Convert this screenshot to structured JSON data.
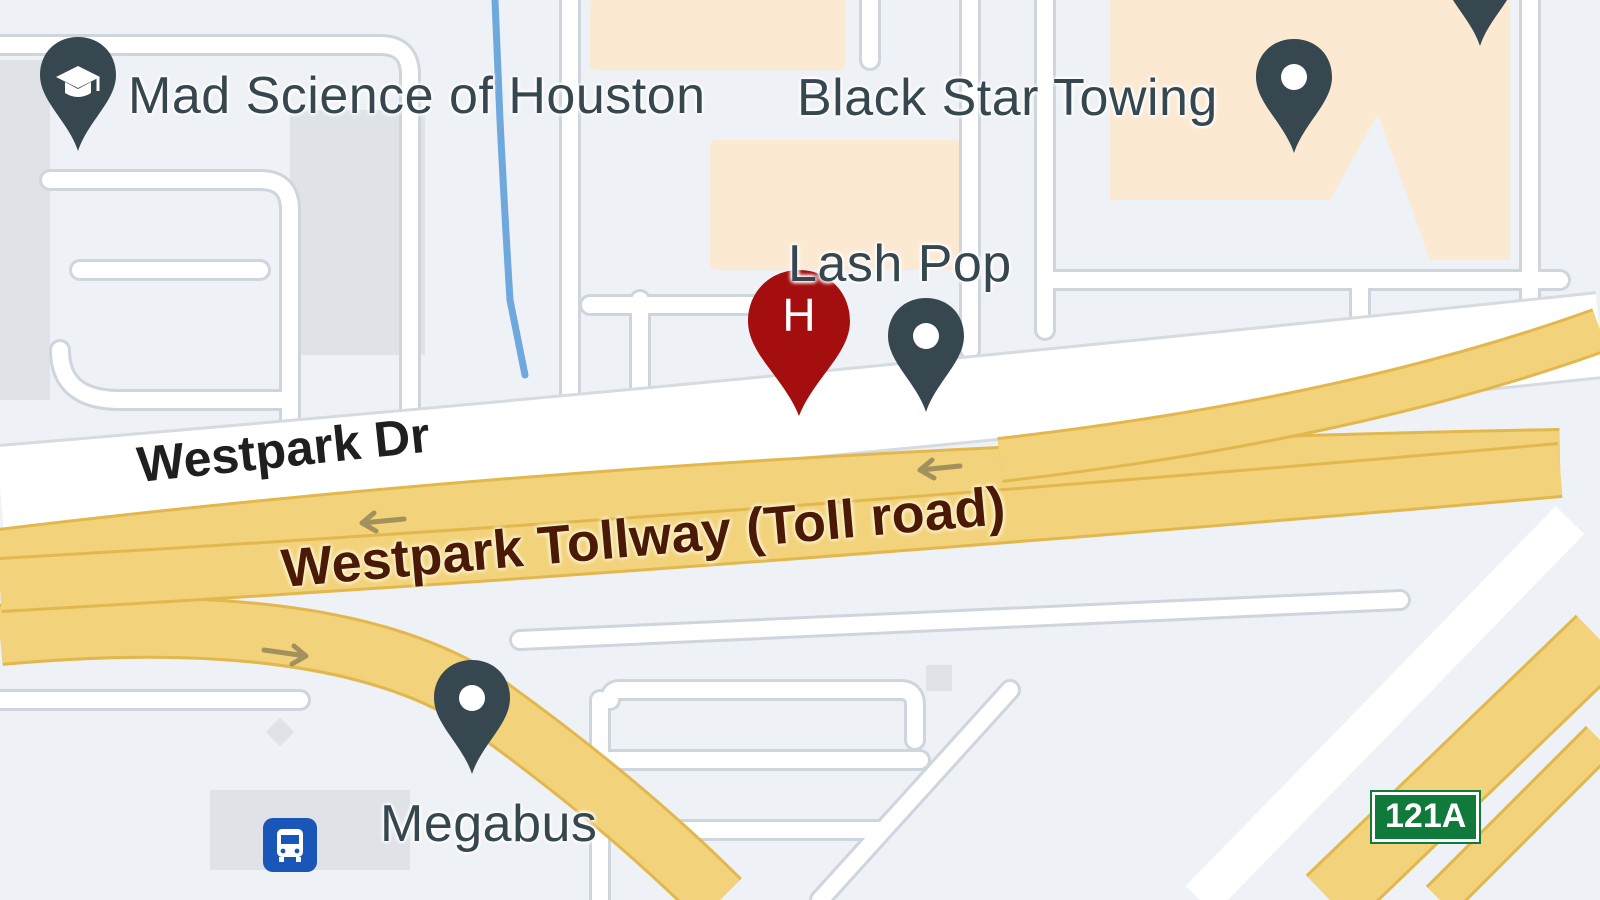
{
  "map": {
    "places": {
      "mad_science": "Mad Science of Houston",
      "black_star": "Black Star Towing",
      "lash_pop": "Lash Pop",
      "megabus": "Megabus"
    },
    "roads": {
      "westpark_dr": "Westpark Dr",
      "westpark_tollway": "Westpark Tollway (Toll road)"
    },
    "exit_shield": "121A",
    "hotel_pin_letter": "H",
    "colors": {
      "background": "#eef1f5",
      "block_fill": "#e2e6ec",
      "street_white": "#ffffff",
      "highway_yellow": "#f2d27a",
      "highway_edge": "#e2b84e",
      "building_peach": "#fbe9d2",
      "water_blue": "#6fa8dc",
      "poi_pin": "#37474f",
      "hotel_pin": "#a50e0e",
      "transit_blue": "#1a56b8",
      "shield_green": "#0f7a3a"
    },
    "icons": [
      "school-icon",
      "place-pin-icon",
      "hotel-pin-icon",
      "bus-station-icon",
      "direction-arrow-icon"
    ]
  }
}
